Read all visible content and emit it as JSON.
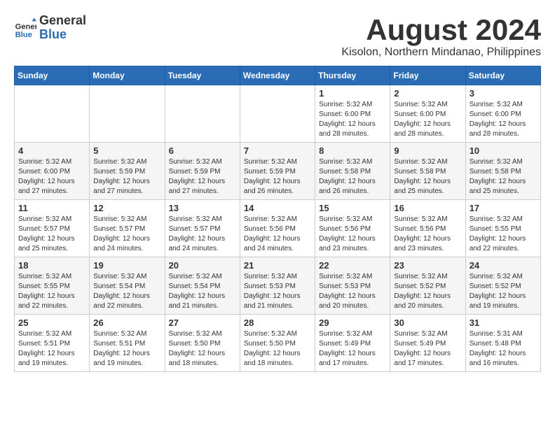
{
  "header": {
    "logo_line1": "General",
    "logo_line2": "Blue",
    "month_year": "August 2024",
    "location": "Kisolon, Northern Mindanao, Philippines"
  },
  "days_of_week": [
    "Sunday",
    "Monday",
    "Tuesday",
    "Wednesday",
    "Thursday",
    "Friday",
    "Saturday"
  ],
  "weeks": [
    [
      {
        "day": "",
        "info": ""
      },
      {
        "day": "",
        "info": ""
      },
      {
        "day": "",
        "info": ""
      },
      {
        "day": "",
        "info": ""
      },
      {
        "day": "1",
        "info": "Sunrise: 5:32 AM\nSunset: 6:00 PM\nDaylight: 12 hours\nand 28 minutes."
      },
      {
        "day": "2",
        "info": "Sunrise: 5:32 AM\nSunset: 6:00 PM\nDaylight: 12 hours\nand 28 minutes."
      },
      {
        "day": "3",
        "info": "Sunrise: 5:32 AM\nSunset: 6:00 PM\nDaylight: 12 hours\nand 28 minutes."
      }
    ],
    [
      {
        "day": "4",
        "info": "Sunrise: 5:32 AM\nSunset: 6:00 PM\nDaylight: 12 hours\nand 27 minutes."
      },
      {
        "day": "5",
        "info": "Sunrise: 5:32 AM\nSunset: 5:59 PM\nDaylight: 12 hours\nand 27 minutes."
      },
      {
        "day": "6",
        "info": "Sunrise: 5:32 AM\nSunset: 5:59 PM\nDaylight: 12 hours\nand 27 minutes."
      },
      {
        "day": "7",
        "info": "Sunrise: 5:32 AM\nSunset: 5:59 PM\nDaylight: 12 hours\nand 26 minutes."
      },
      {
        "day": "8",
        "info": "Sunrise: 5:32 AM\nSunset: 5:58 PM\nDaylight: 12 hours\nand 26 minutes."
      },
      {
        "day": "9",
        "info": "Sunrise: 5:32 AM\nSunset: 5:58 PM\nDaylight: 12 hours\nand 25 minutes."
      },
      {
        "day": "10",
        "info": "Sunrise: 5:32 AM\nSunset: 5:58 PM\nDaylight: 12 hours\nand 25 minutes."
      }
    ],
    [
      {
        "day": "11",
        "info": "Sunrise: 5:32 AM\nSunset: 5:57 PM\nDaylight: 12 hours\nand 25 minutes."
      },
      {
        "day": "12",
        "info": "Sunrise: 5:32 AM\nSunset: 5:57 PM\nDaylight: 12 hours\nand 24 minutes."
      },
      {
        "day": "13",
        "info": "Sunrise: 5:32 AM\nSunset: 5:57 PM\nDaylight: 12 hours\nand 24 minutes."
      },
      {
        "day": "14",
        "info": "Sunrise: 5:32 AM\nSunset: 5:56 PM\nDaylight: 12 hours\nand 24 minutes."
      },
      {
        "day": "15",
        "info": "Sunrise: 5:32 AM\nSunset: 5:56 PM\nDaylight: 12 hours\nand 23 minutes."
      },
      {
        "day": "16",
        "info": "Sunrise: 5:32 AM\nSunset: 5:56 PM\nDaylight: 12 hours\nand 23 minutes."
      },
      {
        "day": "17",
        "info": "Sunrise: 5:32 AM\nSunset: 5:55 PM\nDaylight: 12 hours\nand 22 minutes."
      }
    ],
    [
      {
        "day": "18",
        "info": "Sunrise: 5:32 AM\nSunset: 5:55 PM\nDaylight: 12 hours\nand 22 minutes."
      },
      {
        "day": "19",
        "info": "Sunrise: 5:32 AM\nSunset: 5:54 PM\nDaylight: 12 hours\nand 22 minutes."
      },
      {
        "day": "20",
        "info": "Sunrise: 5:32 AM\nSunset: 5:54 PM\nDaylight: 12 hours\nand 21 minutes."
      },
      {
        "day": "21",
        "info": "Sunrise: 5:32 AM\nSunset: 5:53 PM\nDaylight: 12 hours\nand 21 minutes."
      },
      {
        "day": "22",
        "info": "Sunrise: 5:32 AM\nSunset: 5:53 PM\nDaylight: 12 hours\nand 20 minutes."
      },
      {
        "day": "23",
        "info": "Sunrise: 5:32 AM\nSunset: 5:52 PM\nDaylight: 12 hours\nand 20 minutes."
      },
      {
        "day": "24",
        "info": "Sunrise: 5:32 AM\nSunset: 5:52 PM\nDaylight: 12 hours\nand 19 minutes."
      }
    ],
    [
      {
        "day": "25",
        "info": "Sunrise: 5:32 AM\nSunset: 5:51 PM\nDaylight: 12 hours\nand 19 minutes."
      },
      {
        "day": "26",
        "info": "Sunrise: 5:32 AM\nSunset: 5:51 PM\nDaylight: 12 hours\nand 19 minutes."
      },
      {
        "day": "27",
        "info": "Sunrise: 5:32 AM\nSunset: 5:50 PM\nDaylight: 12 hours\nand 18 minutes."
      },
      {
        "day": "28",
        "info": "Sunrise: 5:32 AM\nSunset: 5:50 PM\nDaylight: 12 hours\nand 18 minutes."
      },
      {
        "day": "29",
        "info": "Sunrise: 5:32 AM\nSunset: 5:49 PM\nDaylight: 12 hours\nand 17 minutes."
      },
      {
        "day": "30",
        "info": "Sunrise: 5:32 AM\nSunset: 5:49 PM\nDaylight: 12 hours\nand 17 minutes."
      },
      {
        "day": "31",
        "info": "Sunrise: 5:31 AM\nSunset: 5:48 PM\nDaylight: 12 hours\nand 16 minutes."
      }
    ]
  ]
}
